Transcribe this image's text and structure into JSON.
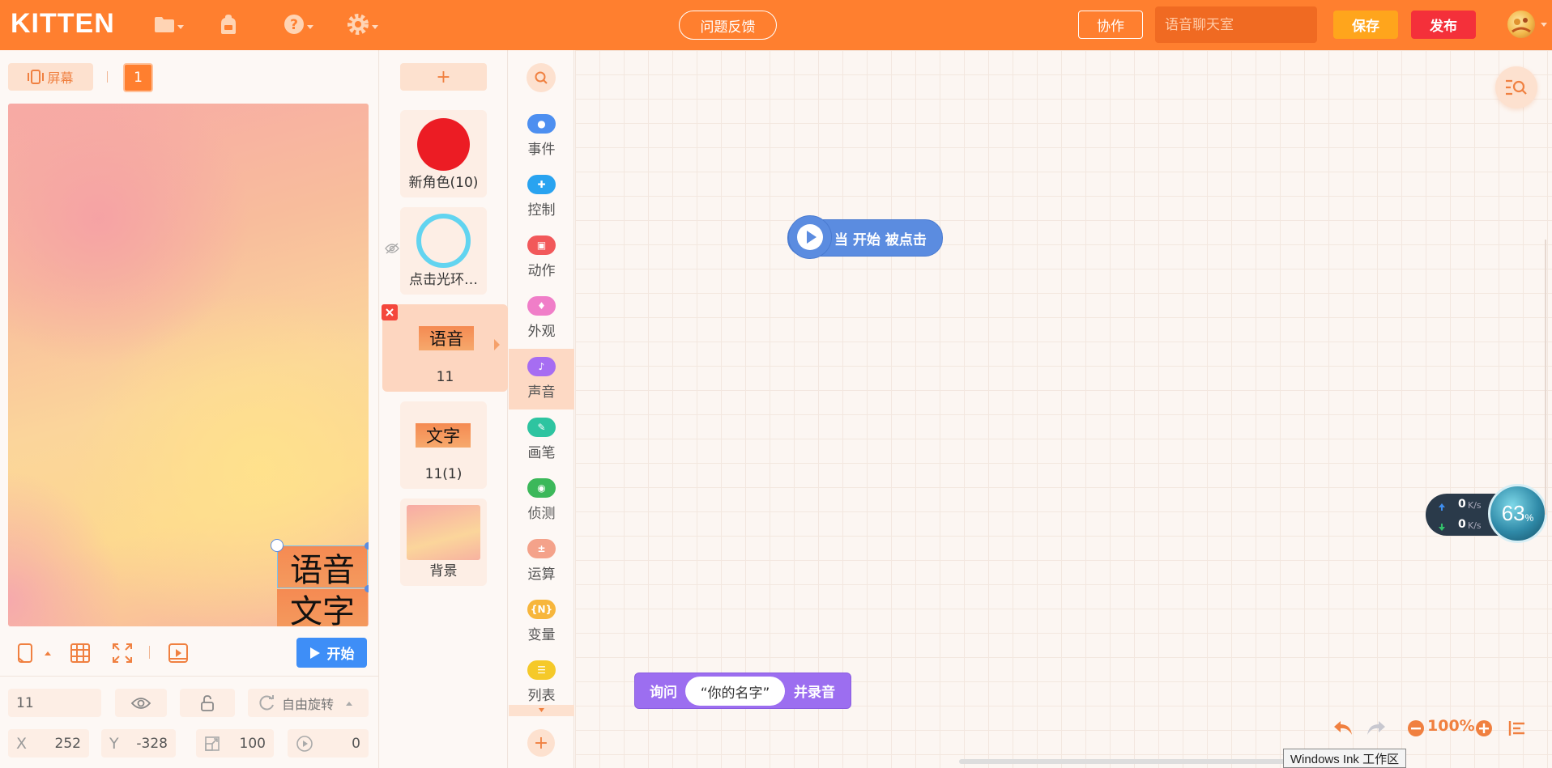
{
  "header": {
    "logo": "KITTEN",
    "feedback_label": "问题反馈",
    "collab_label": "协作",
    "project_name_placeholder": "语音聊天室",
    "save_label": "保存",
    "publish_label": "发布",
    "icons": [
      "folder-icon",
      "backpack-icon",
      "help-icon",
      "settings-icon"
    ]
  },
  "stage_panel": {
    "screen_label": "屏幕",
    "screen_number": "1",
    "sprites_on_stage": [
      "语音",
      "文字"
    ],
    "start_label": "开始",
    "props": {
      "name": "11",
      "rotation_mode": "自由旋转",
      "x_label": "X",
      "x": "252",
      "y_label": "Y",
      "y": "-328",
      "size": "100",
      "direction": "0"
    }
  },
  "sprite_list": {
    "add_label": "+",
    "sprites": [
      {
        "name": "新角色(10)",
        "thumb": "red-circle"
      },
      {
        "name": "点击光环…",
        "thumb": "blue-ring"
      },
      {
        "name": "11",
        "thumb_text": "语音",
        "active": true
      },
      {
        "name": "11(1)",
        "thumb_text": "文字"
      },
      {
        "name": "背景",
        "thumb": "gradient-background"
      }
    ]
  },
  "categories": [
    {
      "label": "事件",
      "color": "#4d8ff0"
    },
    {
      "label": "控制",
      "color": "#29a3f0"
    },
    {
      "label": "动作",
      "color": "#f2585a"
    },
    {
      "label": "外观",
      "color": "#f07ec8"
    },
    {
      "label": "声音",
      "color": "#a66df2",
      "active": true
    },
    {
      "label": "画笔",
      "color": "#2ec4a0"
    },
    {
      "label": "侦测",
      "color": "#3cb85a"
    },
    {
      "label": "运算",
      "color": "#f4a28a"
    },
    {
      "label": "变量",
      "color": "#f7b63c",
      "glyph": "{N}"
    },
    {
      "label": "列表",
      "color": "#f5c929"
    }
  ],
  "workspace": {
    "hat_block": {
      "text": "当 开始 被点击",
      "color": "#5b8ce0"
    },
    "ask_block": {
      "prefix": "询问",
      "input": "“你的名字”",
      "suffix": "并录音",
      "color": "#9c6ef0"
    },
    "zoom": "100%",
    "net": {
      "up": "0",
      "down": "0",
      "unit": "K/s",
      "percent": "63"
    },
    "ink_label": "Windows Ink 工作区"
  }
}
